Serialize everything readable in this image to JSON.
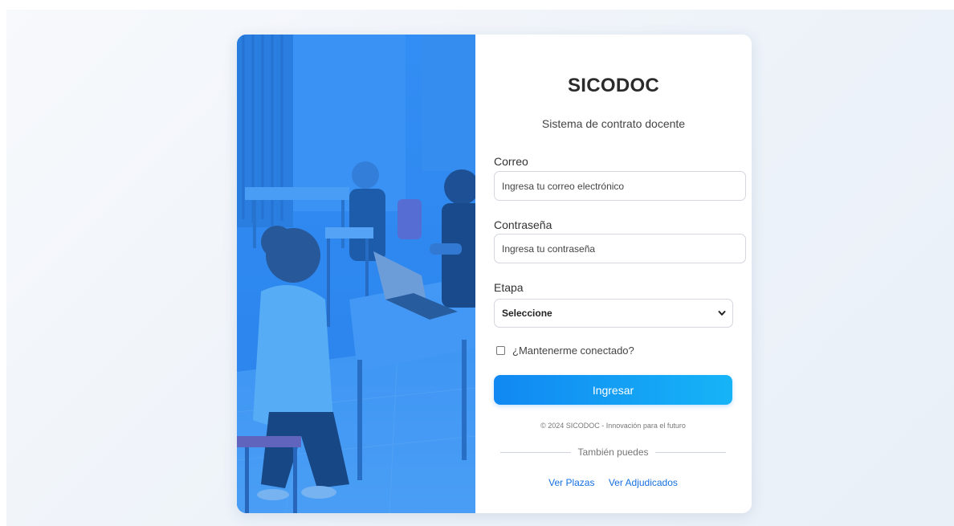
{
  "app": {
    "title": "SICODOC",
    "subtitle": "Sistema de contrato docente"
  },
  "form": {
    "email": {
      "label": "Correo",
      "placeholder": "Ingresa tu correo electrónico",
      "value": ""
    },
    "password": {
      "label": "Contraseña",
      "placeholder": "Ingresa tu contraseña",
      "value": ""
    },
    "stage": {
      "label": "Etapa",
      "selected": "Seleccione"
    },
    "remember": {
      "label": "¿Mantenerme conectado?",
      "checked": false
    },
    "submit_label": "Ingresar"
  },
  "footer": {
    "copyright": "© 2024 SICODOC - Innovación para el futuro",
    "divider_text": "También puedes",
    "links": [
      {
        "label": "Ver Plazas"
      },
      {
        "label": "Ver Adjudicados"
      }
    ]
  },
  "theme": {
    "accent_start": "#1188f2",
    "accent_end": "#16b4f7",
    "photo_tint": "#2f8cf3",
    "link_color": "#1670e0"
  },
  "icons": {
    "select_arrow": "chevron-down-icon"
  }
}
